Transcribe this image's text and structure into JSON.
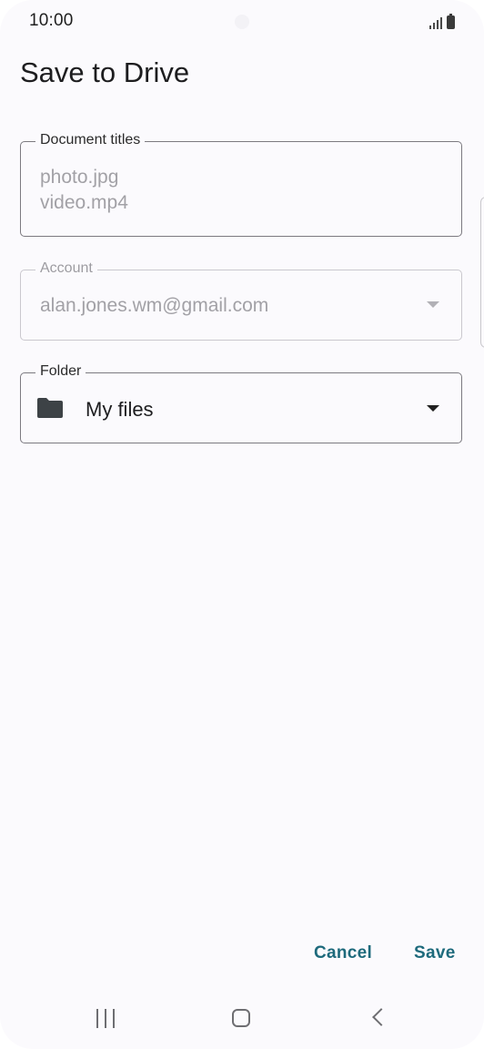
{
  "status_bar": {
    "time": "10:00",
    "icons": [
      "signal-icon",
      "battery-icon"
    ]
  },
  "dialog": {
    "title": "Save to Drive"
  },
  "document_titles": {
    "label": "Document titles",
    "files": [
      "photo.jpg",
      "video.mp4"
    ]
  },
  "account": {
    "label": "Account",
    "value": "alan.jones.wm@gmail.com",
    "icon": "chevron-down-icon"
  },
  "folder": {
    "label": "Folder",
    "value": "My files",
    "icon": "folder-icon"
  },
  "actions": {
    "cancel_label": "Cancel",
    "save_label": "Save"
  },
  "nav_bar": {
    "icons": [
      "recents-icon",
      "home-icon",
      "back-icon"
    ]
  },
  "colors": {
    "background": "#fbfafd",
    "accent": "#1e6a7c",
    "outline": "#7c7a80",
    "disabled_text": "#a2a1a6"
  }
}
